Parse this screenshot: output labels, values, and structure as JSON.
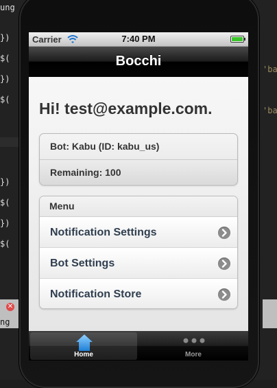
{
  "editor": {
    "left_lines": [
      "ung",
      "})",
      "$(",
      "})",
      "$(",
      "})",
      "$(",
      "",
      "})",
      "$(",
      "})",
      "$("
    ],
    "right_lines": [
      "'bac",
      "'bac"
    ],
    "bottom_text": "ng"
  },
  "status_bar": {
    "carrier": "Carrier",
    "time": "7:40 PM",
    "wifi_icon": "wifi-icon",
    "battery_icon": "battery-icon"
  },
  "nav": {
    "title": "Bocchi"
  },
  "greeting": "Hi! test@example.com.",
  "info": {
    "bot": "Bot: Kabu (ID: kabu_us)",
    "remaining": "Remaining: 100"
  },
  "menu": {
    "header": "Menu",
    "items": [
      {
        "label": "Notification Settings",
        "icon": "chevron-right-icon"
      },
      {
        "label": "Bot Settings",
        "icon": "chevron-right-icon"
      },
      {
        "label": "Notification Store",
        "icon": "chevron-right-icon"
      }
    ]
  },
  "tabs": [
    {
      "label": "Home",
      "icon": "home-icon",
      "active": true
    },
    {
      "label": "More",
      "icon": "more-icon",
      "active": false
    }
  ],
  "colors": {
    "navbar": "#000000",
    "menu_text": "#2f3e4f",
    "home_icon": "#4aa3e8"
  }
}
